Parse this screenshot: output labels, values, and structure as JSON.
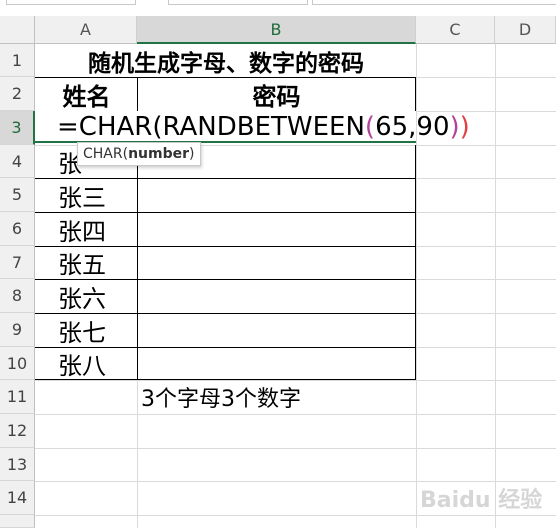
{
  "columns": [
    "A",
    "B",
    "C",
    "D"
  ],
  "rows": [
    "1",
    "2",
    "3",
    "4",
    "5",
    "6",
    "7",
    "8",
    "9",
    "10",
    "11",
    "12",
    "13",
    "14"
  ],
  "title": "随机生成字母、数字的密码",
  "headers": {
    "name": "姓名",
    "password": "密码"
  },
  "formula": {
    "part1": "=CHAR(RANDBETWEEN",
    "open": "(",
    "args": "65,90",
    "close": ")",
    "end": ")"
  },
  "tooltip": {
    "func": "CHAR(",
    "arg": "number",
    "close": ")"
  },
  "names": [
    "张",
    "张三",
    "张四",
    "张五",
    "张六",
    "张七",
    "张八"
  ],
  "note": "3个字母3个数字",
  "watermark": "Baidu 经验"
}
